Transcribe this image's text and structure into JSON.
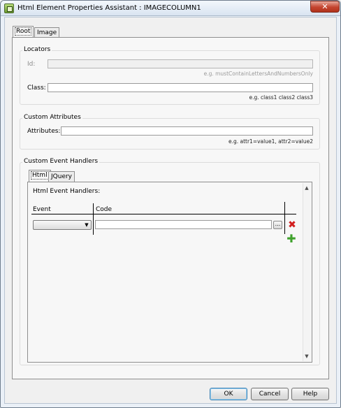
{
  "window": {
    "title": "Html Element Properties Assistant : IMAGECOLUMN1",
    "close_glyph": "✕",
    "app_icon": "html-element-icon"
  },
  "tabs": [
    {
      "label": "Root",
      "active": true
    },
    {
      "label": "Image",
      "active": false
    }
  ],
  "locators": {
    "title": "Locators",
    "id_label": "Id:",
    "id_value": "",
    "id_hint": "e.g. mustContainLettersAndNumbersOnly",
    "class_label": "Class:",
    "class_value": "",
    "class_hint": "e.g. class1 class2 class3"
  },
  "custom_attributes": {
    "title": "Custom Attributes",
    "attributes_label": "Attributes:",
    "attributes_value": "",
    "attributes_hint": "e.g. attr1=value1, attr2=value2"
  },
  "custom_event_handlers": {
    "title": "Custom Event Handlers",
    "tabs": [
      {
        "label": "Html",
        "active": true
      },
      {
        "label": "JQuery",
        "active": false
      }
    ],
    "html_event_handlers_label": "Html Event Handlers:",
    "columns": [
      "Event",
      "Code"
    ],
    "rows": [
      {
        "event": "",
        "code": "",
        "ellipsis": "..."
      }
    ],
    "delete_icon": "delete-icon",
    "add_icon": "add-icon"
  },
  "footer": {
    "ok_label": "OK",
    "cancel_label": "Cancel",
    "help_label": "Help"
  },
  "colors": {
    "delete": "#d21e1e",
    "add": "#3fa12c",
    "default_button_border": "#3c7fb1"
  }
}
